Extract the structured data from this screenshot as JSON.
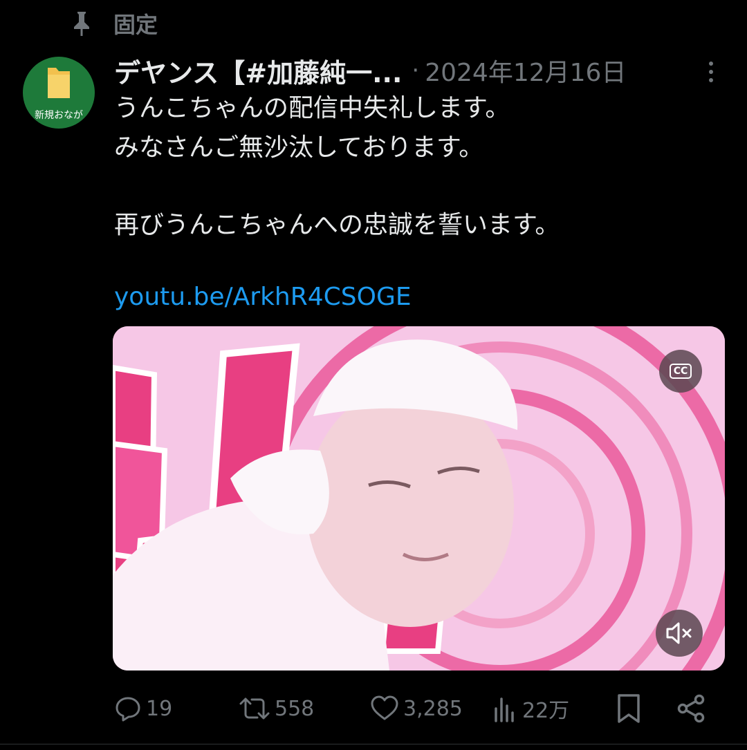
{
  "pinned": {
    "label": "固定"
  },
  "avatar": {
    "caption": "新規おなが"
  },
  "post": {
    "display_name": "デヤンス【#加藤純一...",
    "separator": "·",
    "timestamp": "2024年12月16日",
    "text_line1": "うんこちゃんの配信中失礼します。",
    "text_line2": "みなさんご無沙汰しております。",
    "text_line3": "再びうんこちゃんへの忠誠を誓います。",
    "link": "youtu.be/ArkhR4CSOGE"
  },
  "video": {
    "cc_label": "CC"
  },
  "actions": {
    "replies": "19",
    "reposts": "558",
    "likes": "3,285",
    "views": "22万"
  },
  "colors": {
    "background": "#000000",
    "text": "#e7e9ea",
    "muted": "#71767b",
    "link": "#1d9bf0"
  }
}
